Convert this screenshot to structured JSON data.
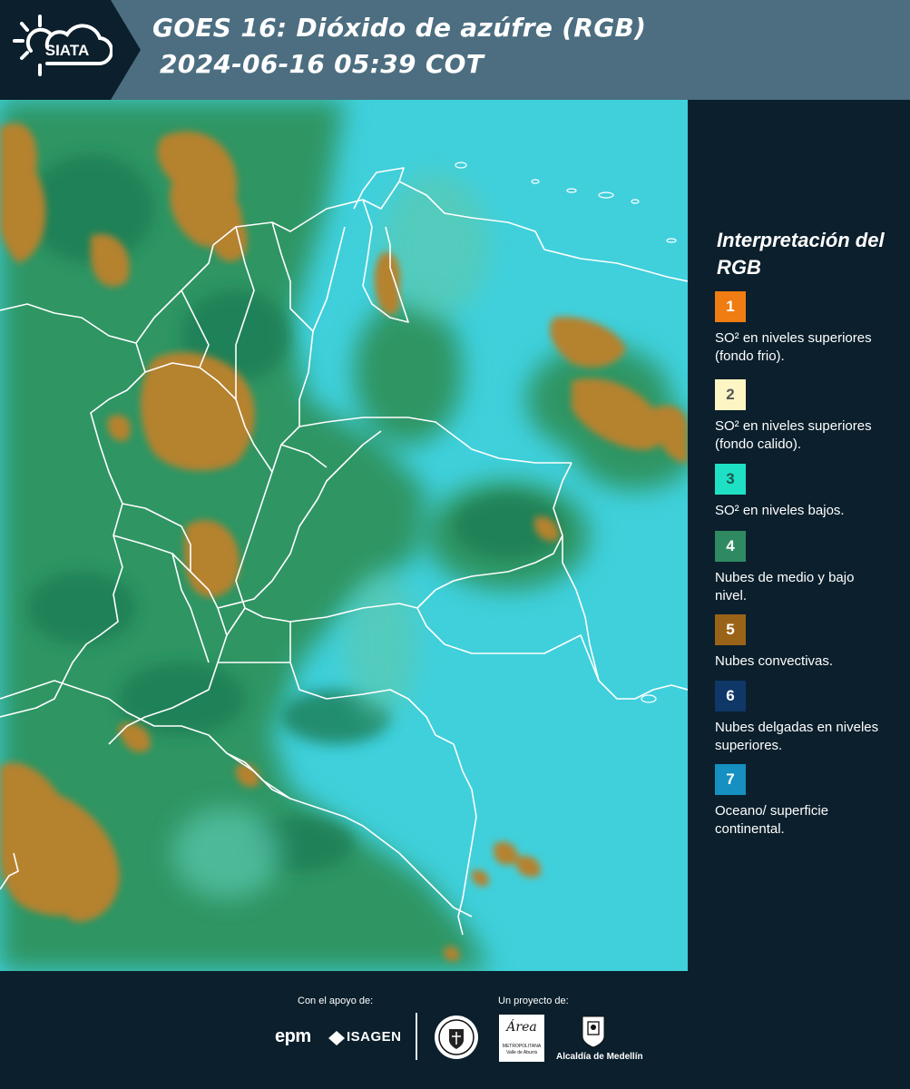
{
  "header": {
    "logo_text": "SIATA",
    "title_line1": "GOES 16: Dióxido de azúfre (RGB)",
    "title_line2": "2024-06-16 05:39 COT"
  },
  "legend": {
    "title": "Interpretación del RGB",
    "items": [
      {
        "number": "1",
        "label": "SO² en niveles superiores (fondo frio).",
        "color": "#f07d12",
        "text_color": "#ffffff"
      },
      {
        "number": "2",
        "label": "SO² en niveles superiores (fondo calido).",
        "color": "#fdf5c4",
        "text_color": "#555555"
      },
      {
        "number": "3",
        "label": "SO² en niveles bajos.",
        "color": "#1ee0c4",
        "text_color": "#1a5a50"
      },
      {
        "number": "4",
        "label": "Nubes de medio y bajo nivel.",
        "color": "#2f8a62",
        "text_color": "#ffffff"
      },
      {
        "number": "5",
        "label": "Nubes convectivas.",
        "color": "#9a6418",
        "text_color": "#ffffff"
      },
      {
        "number": "6",
        "label": "Nubes delgadas en niveles superiores.",
        "color": "#0f3767",
        "text_color": "#ffffff"
      },
      {
        "number": "7",
        "label": "Oceano/ superficie continental.",
        "color": "#1590c0",
        "text_color": "#ffffff"
      }
    ]
  },
  "footer": {
    "support_caption": "Con el apoyo de:",
    "project_caption": "Un proyecto de:",
    "sponsors": [
      "epm",
      "ISAGEN"
    ],
    "partners": [
      "Área",
      "METROPOLITANA Valle de Aburrá",
      "Alcaldía de Medellín"
    ]
  },
  "colors": {
    "background": "#0b1f2c",
    "header_band": "#4c6e80",
    "map_ocean": "#3fcfdc",
    "map_cloud_mid": "#2e9460",
    "map_cloud_convective": "#b3802c",
    "border_lines": "#ffffff"
  }
}
